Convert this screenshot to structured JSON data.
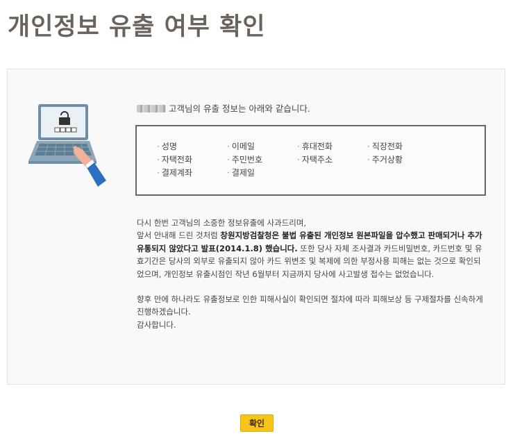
{
  "page": {
    "title": "개인정보 유출 여부 확인"
  },
  "intro": {
    "text": "고객님의 유출 정보는 아래와 같습니다."
  },
  "leaked_items": [
    "성명",
    "이메일",
    "휴대전화",
    "직장전화",
    "자택전화",
    "주민번호",
    "자택주소",
    "주거상황",
    "결제계좌",
    "결제일"
  ],
  "message": {
    "line1": "다시 한번 고객님의 소중한 정보유출에 사과드리며,",
    "line2_a": "앞서 안내해 드린 것처럼 ",
    "line2_bold": "창원지방검찰청은 불법 유출된 개인정보 원본파일을 압수했고 판매되거나 추가 유통되지 않았다고 발표(2014.1.8) 했습니다.",
    "line2_b": " 또한 당사 자체 조사결과 카드비밀번호, 카드번호 및 유효기간은 당사의 외부로 유출되지 않아 카드 위변조 및 복제에 의한 부정사용 피해는 없는 것으로 확인되었으며, 개인정보 유출시점인 작년 6월부터 지금까지 당사에 사고발생 접수는 없었습니다.",
    "line3": "향후 만에 하나라도 유출정보로 인한 피해사실이 확인되면 절차에 따라 피해보상 등 구제절차를 신속하게 진행하겠습니다.",
    "line4": "감사합니다."
  },
  "confirm_button": {
    "label": "확인"
  },
  "colors": {
    "title": "#6b635a",
    "box_border": "#6e645a",
    "button_bg": "#f8c41a"
  },
  "icons": {
    "illustration": "laptop-lock-icon"
  }
}
